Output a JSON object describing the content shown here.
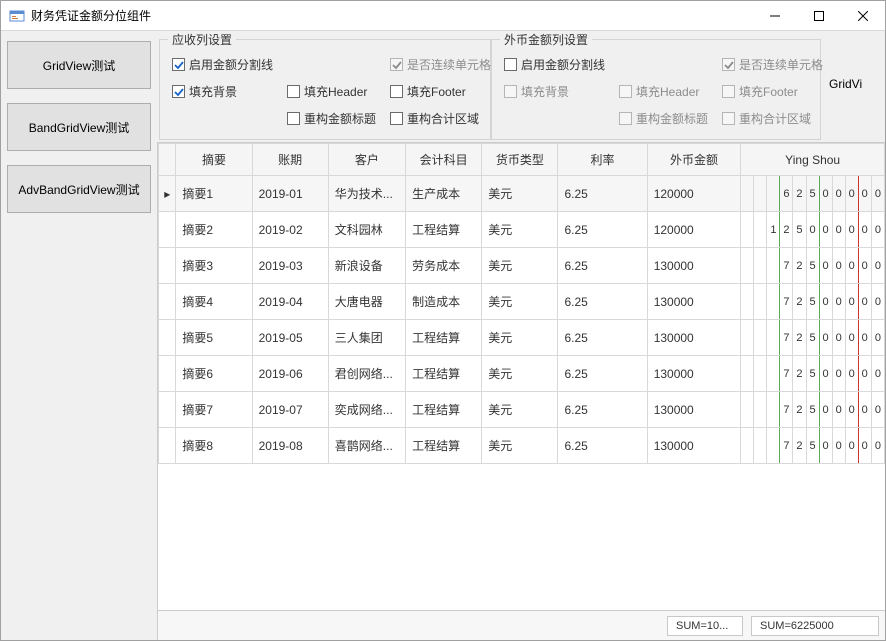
{
  "title": "财务凭证金额分位组件",
  "sidebar": {
    "buttons": [
      "GridView测试",
      "BandGridView测试",
      "AdvBandGridView测试"
    ]
  },
  "settings": {
    "left": {
      "title": "应收列设置",
      "items": [
        {
          "label": "启用金额分割线",
          "checked": true,
          "disabled": false
        },
        {
          "label": "是否连续单元格",
          "checked": true,
          "disabled": true
        },
        {
          "label": "填充背景",
          "checked": true,
          "disabled": false
        },
        {
          "label": "填充Header",
          "checked": false,
          "disabled": false
        },
        {
          "label": "填充Footer",
          "checked": false,
          "disabled": false
        },
        {
          "label": "重构金额标题",
          "checked": false,
          "disabled": false
        },
        {
          "label": "重构合计区域",
          "checked": false,
          "disabled": false
        }
      ]
    },
    "right": {
      "title": "外币金额列设置",
      "items": [
        {
          "label": "启用金额分割线",
          "checked": false,
          "disabled": false
        },
        {
          "label": "是否连续单元格",
          "checked": true,
          "disabled": true
        },
        {
          "label": "填充背景",
          "checked": false,
          "disabled": true
        },
        {
          "label": "填充Header",
          "checked": false,
          "disabled": true
        },
        {
          "label": "填充Footer",
          "checked": false,
          "disabled": true
        },
        {
          "label": "重构金额标题",
          "checked": false,
          "disabled": true
        },
        {
          "label": "重构合计区域",
          "checked": false,
          "disabled": true
        }
      ]
    },
    "extra_button": "GridVi"
  },
  "grid": {
    "columns": [
      "摘要",
      "账期",
      "客户",
      "会计科目",
      "货币类型",
      "利率",
      "外币金额"
    ],
    "money_band": "Ying Shou",
    "rows": [
      {
        "focused": true,
        "cells": [
          "摘要1",
          "2019-01",
          "华为技术...",
          "生产成本",
          "美元",
          "6.25",
          "120000"
        ],
        "digits": [
          "",
          "",
          "",
          "6",
          "2",
          "5",
          "0",
          "0",
          "0",
          "0",
          "0"
        ]
      },
      {
        "focused": false,
        "cells": [
          "摘要2",
          "2019-02",
          "文科园林",
          "工程结算",
          "美元",
          "6.25",
          "120000"
        ],
        "digits": [
          "",
          "",
          "1",
          "2",
          "5",
          "0",
          "0",
          "0",
          "0",
          "0",
          "0"
        ]
      },
      {
        "focused": false,
        "cells": [
          "摘要3",
          "2019-03",
          "新浪设备",
          "劳务成本",
          "美元",
          "6.25",
          "130000"
        ],
        "digits": [
          "",
          "",
          "",
          "7",
          "2",
          "5",
          "0",
          "0",
          "0",
          "0",
          "0"
        ]
      },
      {
        "focused": false,
        "cells": [
          "摘要4",
          "2019-04",
          "大唐电器",
          "制造成本",
          "美元",
          "6.25",
          "130000"
        ],
        "digits": [
          "",
          "",
          "",
          "7",
          "2",
          "5",
          "0",
          "0",
          "0",
          "0",
          "0"
        ]
      },
      {
        "focused": false,
        "cells": [
          "摘要5",
          "2019-05",
          "三人集团",
          "工程结算",
          "美元",
          "6.25",
          "130000"
        ],
        "digits": [
          "",
          "",
          "",
          "7",
          "2",
          "5",
          "0",
          "0",
          "0",
          "0",
          "0"
        ]
      },
      {
        "focused": false,
        "cells": [
          "摘要6",
          "2019-06",
          "君创网络...",
          "工程结算",
          "美元",
          "6.25",
          "130000"
        ],
        "digits": [
          "",
          "",
          "",
          "7",
          "2",
          "5",
          "0",
          "0",
          "0",
          "0",
          "0"
        ]
      },
      {
        "focused": false,
        "cells": [
          "摘要7",
          "2019-07",
          "奕成网络...",
          "工程结算",
          "美元",
          "6.25",
          "130000"
        ],
        "digits": [
          "",
          "",
          "",
          "7",
          "2",
          "5",
          "0",
          "0",
          "0",
          "0",
          "0"
        ]
      },
      {
        "focused": false,
        "cells": [
          "摘要8",
          "2019-08",
          "喜鹊网络...",
          "工程结算",
          "美元",
          "6.25",
          "130000"
        ],
        "digits": [
          "",
          "",
          "",
          "7",
          "2",
          "5",
          "0",
          "0",
          "0",
          "0",
          "0"
        ]
      }
    ],
    "footer": {
      "sum_left": "SUM=10...",
      "sum_right": "SUM=6225000"
    }
  }
}
